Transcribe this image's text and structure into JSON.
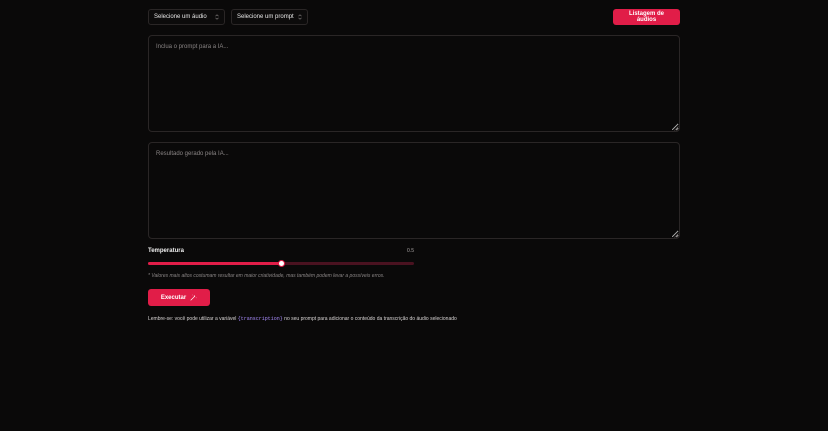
{
  "toolbar": {
    "audio_select": "Selecione um áudio",
    "prompt_select": "Selecione um prompt",
    "list_audios_button": "Listagem de áudios"
  },
  "prompt_input": {
    "value": "",
    "placeholder": "Inclua o prompt para a IA..."
  },
  "result_output": {
    "value": "",
    "placeholder": "Resultado gerado pela IA..."
  },
  "temperature": {
    "label": "Temperatura",
    "value": "0.5",
    "min": 0,
    "max": 1,
    "hint": "* Valores mais altos costumam resultar em maior criatividade, mas também podem levar a possíveis erros."
  },
  "run_button": {
    "label": "Executar",
    "icon": "magic-wand-icon"
  },
  "note": {
    "before": "Lembre-se: você pode utilizar a variável ",
    "variable": "{transcription}",
    "after": " no seu prompt para adicionar o conteúdo da transcrição do áudio selecionado"
  },
  "colors": {
    "background": "#0a0909",
    "accent": "#e11d48",
    "border": "#2a2626",
    "variable": "#a78bfa"
  }
}
